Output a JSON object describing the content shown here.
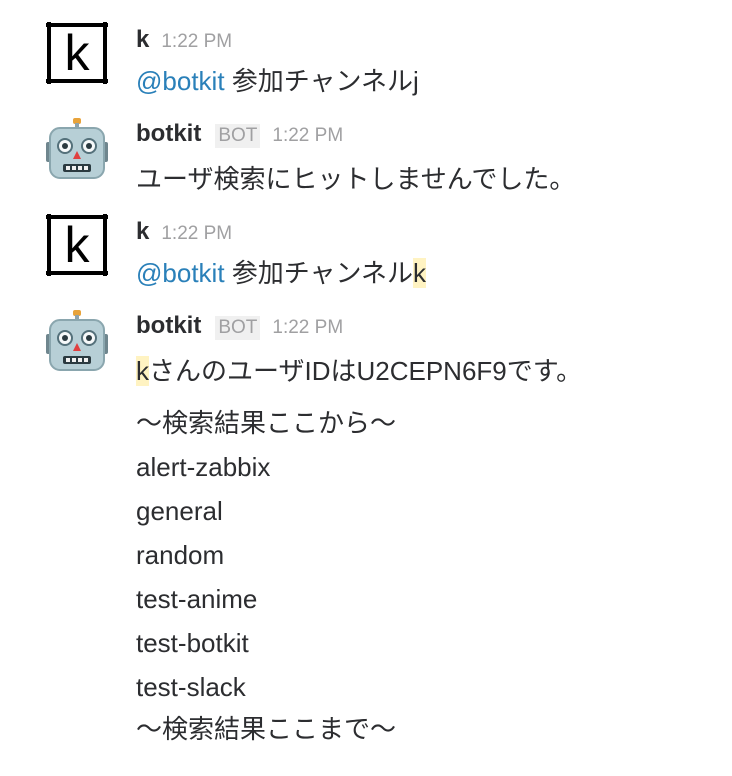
{
  "messages": [
    {
      "user": "k",
      "time": "1:22 PM",
      "mention": "@botkit",
      "text_before_hl": " 参加チャンネル",
      "text_plain_end": "j"
    },
    {
      "user": "botkit",
      "badge": "BOT",
      "time": "1:22 PM",
      "text": "ユーザ検索にヒットしませんでした。"
    },
    {
      "user": "k",
      "time": "1:22 PM",
      "mention": "@botkit",
      "text_before_hl": " 参加チャンネル",
      "highlight": "k"
    },
    {
      "user": "botkit",
      "badge": "BOT",
      "time": "1:22 PM",
      "highlight": "k",
      "first_line_rest": "さんのユーザIDはU2CEPN6F9です。",
      "lines": [
        "〜検索結果ここから〜",
        "alert-zabbix",
        "general",
        "random",
        "test-anime",
        "test-botkit",
        "test-slack",
        "〜検索結果ここまで〜"
      ]
    }
  ],
  "colors": {
    "mention": "#2a80b9",
    "highlight": "#fff3c2",
    "timestamp": "#a0a0a2",
    "text": "#2c2d30"
  },
  "icons": {
    "user_avatar": "k-letter-avatar",
    "bot_avatar": "robot-face-icon"
  }
}
